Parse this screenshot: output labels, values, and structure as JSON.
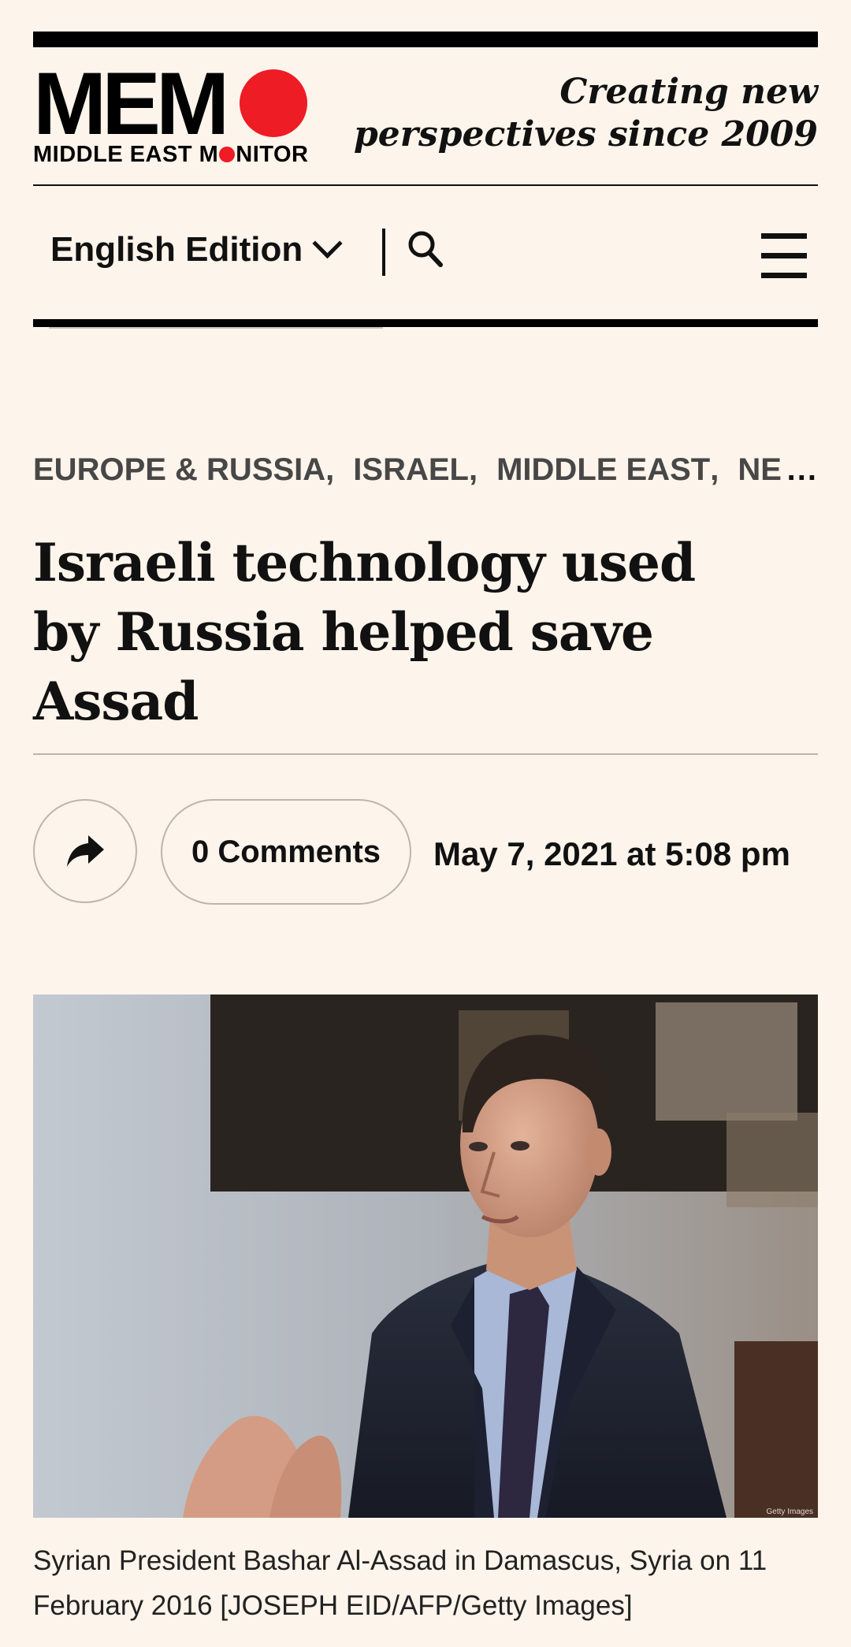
{
  "brand": {
    "logo_main": "MEM",
    "logo_sub_before": "MIDDLE EAST M",
    "logo_sub_after": "NITOR",
    "tagline_line1": "Creating new",
    "tagline_line2": "perspectives since 2009",
    "accent_color": "#ee1c25"
  },
  "nav": {
    "edition_label": "English Edition",
    "search_icon": "search-icon",
    "menu_icon": "hamburger-menu-icon"
  },
  "article": {
    "categories": [
      "EUROPE & RUSSIA",
      "ISRAEL",
      "MIDDLE EAST",
      "NEWS"
    ],
    "category_separator": ",",
    "more_indicator": "...",
    "headline": "Israeli technology used by Russia helped save Assad",
    "share_icon": "share-arrow-icon",
    "comments_label": "0 Comments",
    "date": "May 7, 2021 at 5:08 pm",
    "photo_credit_mark": "Getty Images",
    "caption": "Syrian President Bashar Al-Assad in Damascus, Syria on 11 February 2016 [JOSEPH EID/AFP/Getty Images]"
  }
}
